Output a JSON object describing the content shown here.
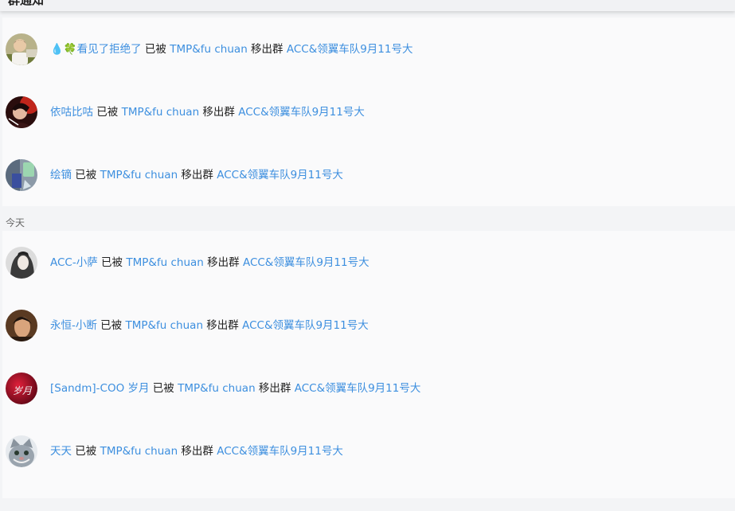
{
  "header": {
    "title": "群通知"
  },
  "sections": [
    {
      "label": "",
      "items": [
        {
          "user": "💧🍀看见了拒绝了",
          "action_prefix": "已被",
          "operator": "TMP&fu chuan",
          "action_suffix": "移出群",
          "group": "ACC&领翼车队9月11号大",
          "avatar_icon": "avatar-boy-photo"
        },
        {
          "user": "依咕比咕",
          "action_prefix": "已被",
          "operator": "TMP&fu chuan",
          "action_suffix": "移出群",
          "group": "ACC&领翼车队9月11号大",
          "avatar_icon": "avatar-red-portrait"
        },
        {
          "user": "绘镝",
          "action_prefix": "已被",
          "operator": "TMP&fu chuan",
          "action_suffix": "移出群",
          "group": "ACC&领翼车队9月11号大",
          "avatar_icon": "avatar-blue-green"
        }
      ]
    },
    {
      "label": "今天",
      "items": [
        {
          "user": "ACC-小萨",
          "action_prefix": "已被",
          "operator": "TMP&fu chuan",
          "action_suffix": "移出群",
          "group": "ACC&领翼车队9月11号大",
          "avatar_icon": "avatar-woman-bw"
        },
        {
          "user": "永恒-小断",
          "action_prefix": "已被",
          "operator": "TMP&fu chuan",
          "action_suffix": "移出群",
          "group": "ACC&领翼车队9月11号大",
          "avatar_icon": "avatar-man-photo"
        },
        {
          "user": "[Sandm]-COO 岁月",
          "action_prefix": "已被",
          "operator": "TMP&fu chuan",
          "action_suffix": "移出群",
          "group": "ACC&领翼车队9月11号大",
          "avatar_icon": "avatar-red-text",
          "avatar_text": "岁月"
        },
        {
          "user": "天天",
          "action_prefix": "已被",
          "operator": "TMP&fu chuan",
          "action_suffix": "移出群",
          "group": "ACC&领翼车队9月11号大",
          "avatar_icon": "avatar-cat"
        }
      ]
    }
  ],
  "colors": {
    "link": "#3d8fdf",
    "text": "#222222",
    "card": "#fafafb",
    "background": "#f3f4f6"
  }
}
